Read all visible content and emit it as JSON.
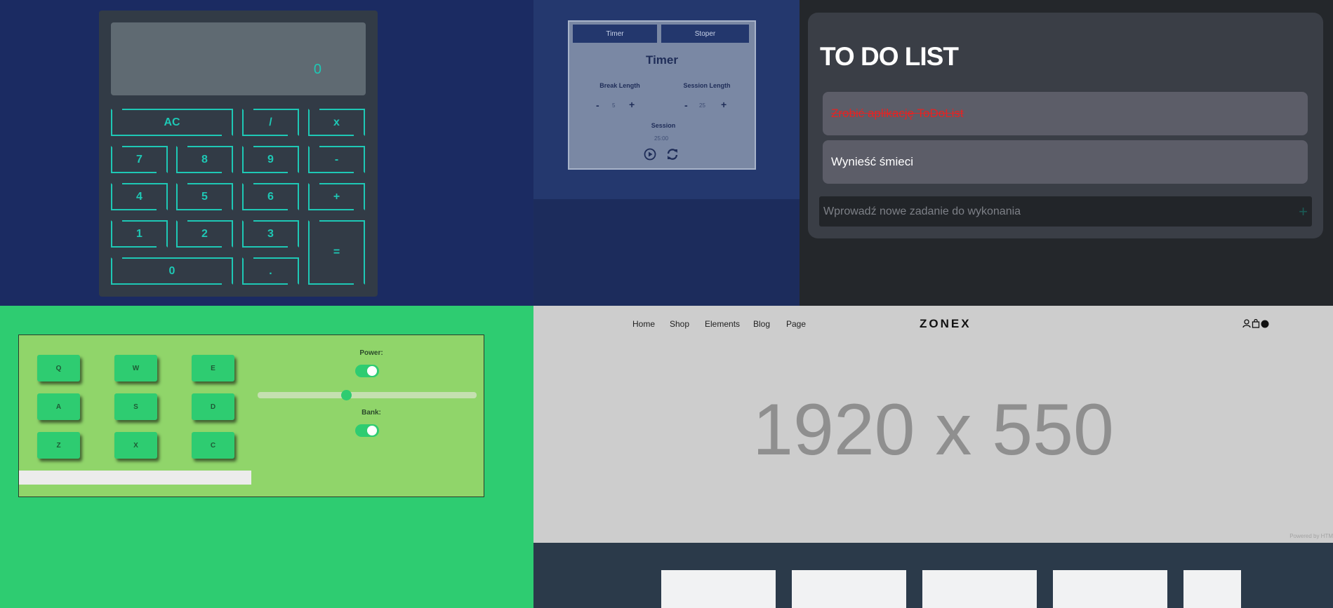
{
  "calculator": {
    "display_value": "0",
    "buttons": [
      "AC",
      "/",
      "x",
      "7",
      "8",
      "9",
      "-",
      "4",
      "5",
      "6",
      "+",
      "1",
      "2",
      "3",
      "=",
      "0",
      "."
    ],
    "accent_color": "#1ec8b5"
  },
  "timer": {
    "tabs": [
      "Timer",
      "Stoper"
    ],
    "title": "Timer",
    "break_label": "Break Length",
    "break_value": "5",
    "session_label": "Session Length",
    "session_value": "25",
    "minus": "-",
    "plus": "+",
    "current_label": "Session",
    "current_time": "25:00",
    "play_icon": "play-circle-icon",
    "reset_icon": "refresh-icon"
  },
  "todo": {
    "title": "TO DO LIST",
    "items": [
      {
        "text": "Zrobić aplikację ToDoList",
        "done": true
      },
      {
        "text": "Wynieść śmieci",
        "done": false
      }
    ],
    "input_placeholder": "Wprowadź nowe zadanie do wykonania",
    "add_symbol": "+"
  },
  "drum": {
    "pads": [
      "Q",
      "W",
      "E",
      "A",
      "S",
      "D",
      "Z",
      "X",
      "C"
    ],
    "power_label": "Power:",
    "bank_label": "Bank:",
    "power_on": true,
    "bank_on": true,
    "volume": 0.4
  },
  "zonex": {
    "nav": [
      "Home",
      "Shop",
      "Elements",
      "Blog",
      "Page"
    ],
    "logo": "ZONEX",
    "hero_text": "1920 x 550",
    "powered_by": "Powered by HTM"
  }
}
